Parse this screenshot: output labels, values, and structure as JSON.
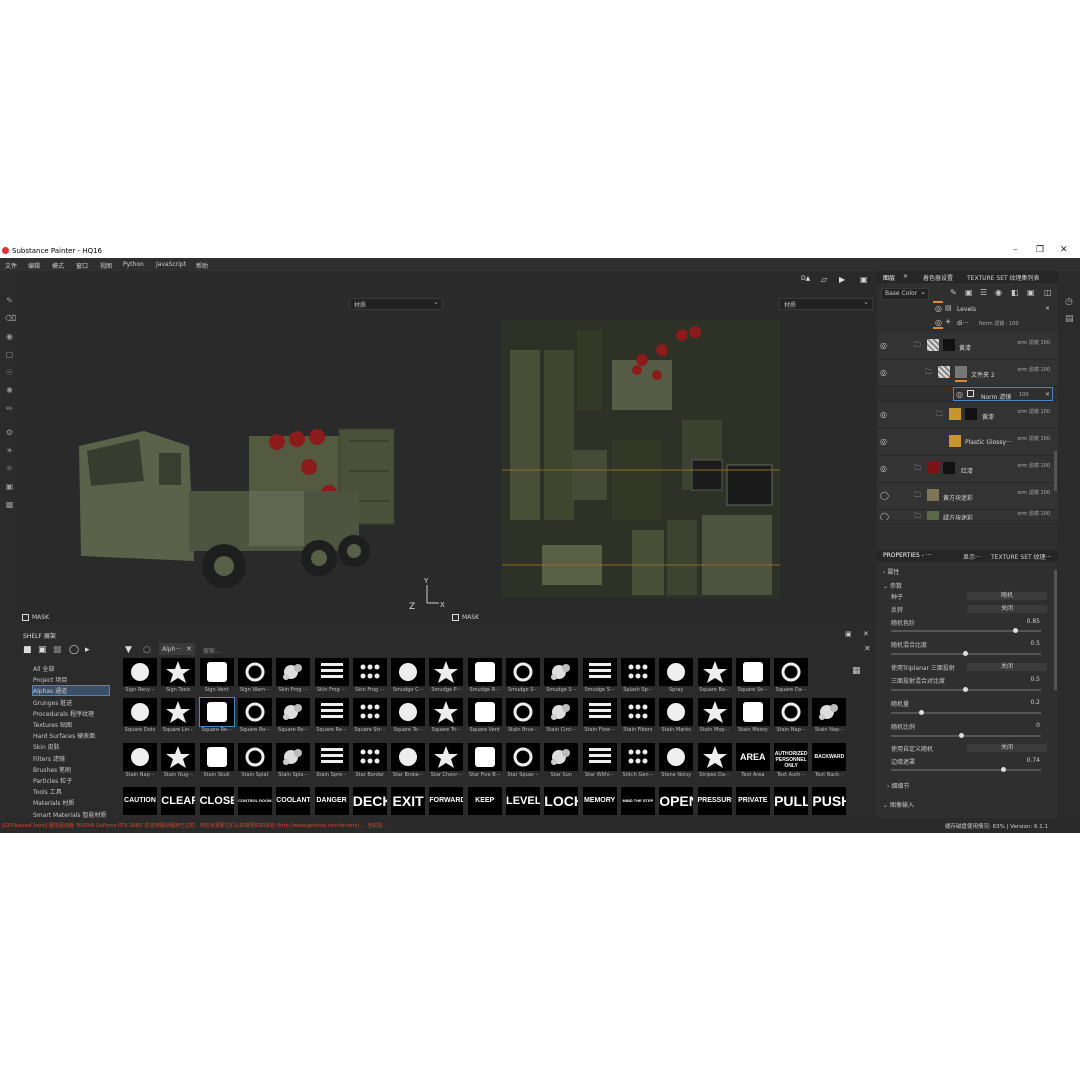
{
  "app": {
    "title": "Substance Painter - HQ16"
  },
  "menu": [
    "文件",
    "编辑",
    "模式",
    "窗口",
    "视图",
    "Python",
    "JavaScript",
    "帮助"
  ],
  "viewport": {
    "selector_3d": "材质",
    "selector_2d": "材质",
    "mask_label": "MASK",
    "axis_z": "Z",
    "axis_y": "Y",
    "axis_x": "X"
  },
  "layers_panel": {
    "tabs": [
      "图层",
      "着色器设置",
      "TEXTURE SET 纹理集列表"
    ],
    "channel": "Base Color",
    "layers": [
      {
        "name": "Levels",
        "blend": ""
      },
      {
        "name": "di···",
        "blend": "Norm 滤镜 · 100"
      },
      {
        "name": "黄漆",
        "blend": "orm 滤镜 100"
      },
      {
        "name": "文件夹 2",
        "blend": "orm 滤镜 100"
      },
      {
        "name": "Norm 滤镜",
        "blend": "100"
      },
      {
        "name": "黄漆",
        "blend": "orm 滤镜 100"
      },
      {
        "name": "Plastic Glossy···",
        "blend": "orm 滤镜 100"
      },
      {
        "name": "红漆",
        "blend": "orm 滤镜 100"
      },
      {
        "name": "黄方块迷彩",
        "blend": "orm 滤镜 100"
      },
      {
        "name": "绿方块迷彩",
        "blend": "orm 滤镜 100"
      }
    ]
  },
  "properties": {
    "tabs": [
      "PROPERTIES - ···",
      "显示···",
      "TEXTURE SET 纹理···"
    ],
    "section_attr": "属性",
    "section_params": "参数",
    "rows": [
      {
        "label": "种子",
        "button": "随机"
      },
      {
        "label": "反转",
        "button": "关闭"
      },
      {
        "label": "随机色阶",
        "value": "0.85",
        "slider": 0.85
      },
      {
        "label": "随机混合比度",
        "value": "0.5",
        "slider": 0.5
      },
      {
        "label": "使用Triplanar 三面投射",
        "button": "关闭"
      },
      {
        "label": "三面投射混合对比度",
        "value": "0.5",
        "slider": 0.5
      },
      {
        "label": "随机量",
        "value": "0.2",
        "slider": 0.2
      },
      {
        "label": "随机比例",
        "value": "0",
        "slider": 0.0
      },
      {
        "label": "使用自定义随机",
        "button": "关闭"
      },
      {
        "label": "边缘遮罩",
        "value": "0.74",
        "slider": 0.74
      }
    ],
    "section_details": "细细节",
    "section_image_input": "图像输入"
  },
  "shelf": {
    "title": "SHELF 展架",
    "search_tab": "Alph···",
    "search_placeholder": "搜索...",
    "categories": [
      "All 全部",
      "Project 项目",
      "Alphas 通道",
      "Grunges 脏迹",
      "Procedurals 程序纹理",
      "Textures 贴图",
      "Hard Surfaces 硬表面",
      "Skin 皮肤",
      "Filters 滤镜",
      "Brushes 笔刷",
      "Particles 粒子",
      "Tools 工具",
      "Materials 材质",
      "Smart Materials 智能材质"
    ],
    "selected_category": 2,
    "rows": [
      [
        "Sign Recy···",
        "Sign Toxic",
        "Sign Vent",
        "Sign Warn···",
        "Skin Frog ···",
        "Skin Frog ···",
        "Skin Frog ···",
        "Smudge C···",
        "Smudge P···",
        "Smudge R···",
        "Smudge S···",
        "Smudge S···",
        "Smudge S···",
        "Splash Sp···",
        "Spray",
        "Square Ba···",
        "Square So···",
        "Square Da···"
      ],
      [
        "Square Dots",
        "Square Lin···",
        "Square Re···",
        "Square Ro···",
        "Square Ro···",
        "Square Ro···",
        "Square Str···",
        "Square To···",
        "Square Tri···",
        "Square Vent",
        "Stain Brus···",
        "Stain Circl···",
        "Stain Flow···",
        "Stain Fibers",
        "Stain Marks",
        "Stain Mop···",
        "Stain Mossy",
        "Stain Nap···",
        "Stain Nap···"
      ],
      [
        "Stain Nap···",
        "Stain Nug···",
        "Stain Skull",
        "Stain Splat",
        "Stain Spla···",
        "Stain Spre···",
        "Star Border",
        "Star Broke···",
        "Star Chevr···",
        "Star Five B···",
        "Star Squar···",
        "Star Sun",
        "Star Withi···",
        "Stitch Gen···",
        "Stone Noisy",
        "Stripes Da···",
        "Text Area",
        "Text Auth···",
        "Text Back···"
      ],
      [
        "CAUTION",
        "CLEAR",
        "CLOSE",
        "CONTROL ROOM",
        "COOLANT",
        "DANGER",
        "DECK",
        "EXIT",
        "FORWARD",
        "KEEP OUT",
        "LEVEL",
        "LOCK",
        "MEMORY",
        "MIND THE STEP",
        "OPEN",
        "PRESSURE",
        "PRIVATE",
        "PULL",
        "PUSH"
      ]
    ],
    "text_area_words": [
      "AREA",
      "AUTHORIZED PERSONNEL ONLY",
      "BACKWARD"
    ]
  },
  "status": {
    "error": "[GPUIssuesCheck] 图形驱动版 'NVIDIA GeForce RTX 2060' 的支持驱动程序已过时，你应该更新它们以获得更好的体验 (http://www.geforce.com/drivers) 。 当前显···",
    "memory": "缓存磁盘使用情况: 63% | Version: 6.1.1"
  }
}
